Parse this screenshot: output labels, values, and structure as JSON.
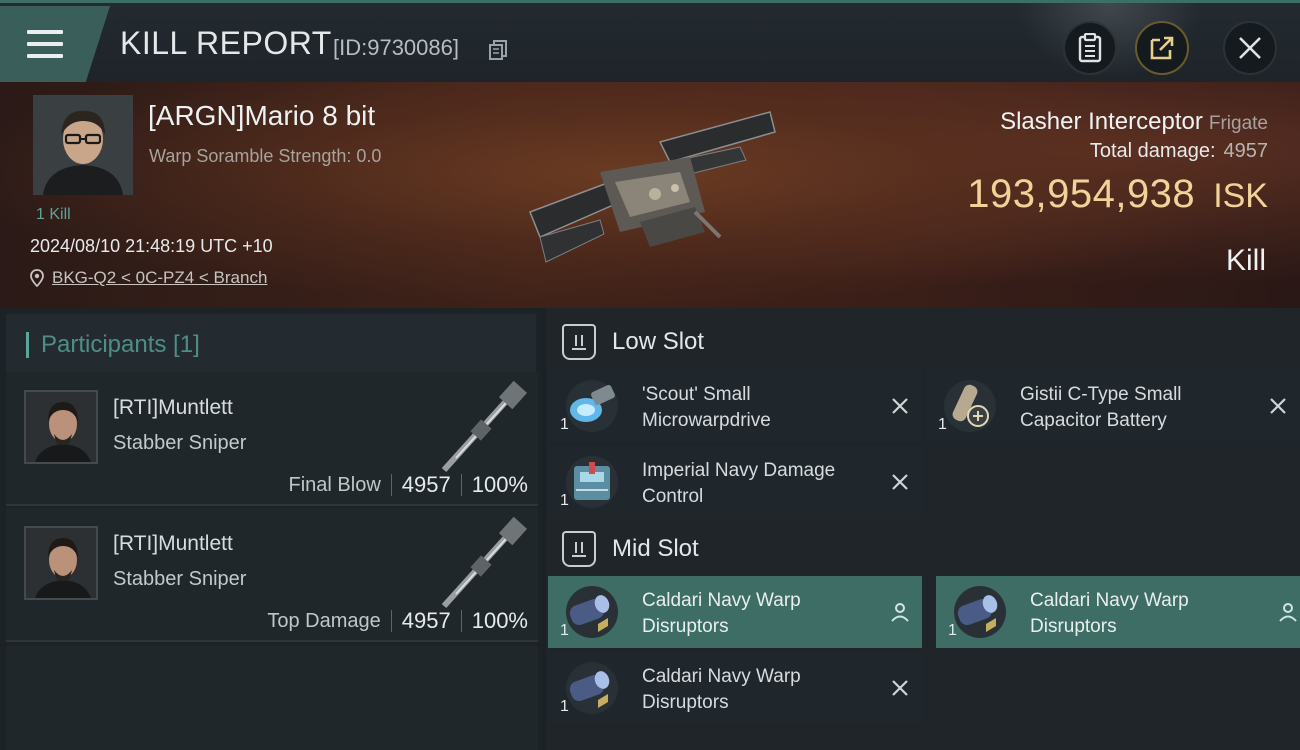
{
  "header": {
    "title": "KILL REPORT",
    "id_text": "[ID:9730086]",
    "menu_icon": "hamburger-menu-icon",
    "clipboard_icon": "clipboard-icon",
    "share_icon": "share-export-icon",
    "close_icon": "close-icon"
  },
  "victim": {
    "name": "[ARGN]Mario 8 bit",
    "warp_scramble": "Warp Soramble Strength: 0.0",
    "kill_count": "1 Kill",
    "timestamp": "2024/08/10 21:48:19 UTC +10",
    "location": "BKG-Q2 < 0C-PZ4 < Branch"
  },
  "ship": {
    "name": "Slasher Interceptor",
    "class": "Frigate",
    "total_damage_label": "Total damage:",
    "total_damage": "4957",
    "isk_value": "193,954,938",
    "isk_unit": "ISK",
    "result": "Kill"
  },
  "participants": {
    "title": "Participants [1]",
    "rows": [
      {
        "name": "[RTI]Muntlett",
        "ship": "Stabber Sniper",
        "label": "Final Blow",
        "damage": "4957",
        "percent": "100%"
      },
      {
        "name": "[RTI]Muntlett",
        "ship": "Stabber Sniper",
        "label": "Top Damage",
        "damage": "4957",
        "percent": "100%"
      }
    ]
  },
  "fitting": {
    "low_slot": {
      "title": "Low Slot",
      "modules": [
        {
          "name": "'Scout' Small Microwarpdrive",
          "qty": "1",
          "status": "destroyed"
        },
        {
          "name": "Gistii C-Type Small Capacitor Battery",
          "qty": "1",
          "status": "destroyed"
        },
        {
          "name": "Imperial Navy Damage Control",
          "qty": "1",
          "status": "destroyed"
        }
      ]
    },
    "mid_slot": {
      "title": "Mid Slot",
      "modules": [
        {
          "name": "Caldari Navy Warp Disruptors",
          "qty": "1",
          "status": "dropped"
        },
        {
          "name": "Caldari Navy Warp Disruptors",
          "qty": "1",
          "status": "dropped"
        },
        {
          "name": "Caldari Navy Warp Disruptors",
          "qty": "1",
          "status": "destroyed"
        }
      ]
    }
  },
  "colors": {
    "accent_teal": "#3e6d66",
    "isk_gold": "#f1d39a",
    "background": "#1c2125"
  }
}
